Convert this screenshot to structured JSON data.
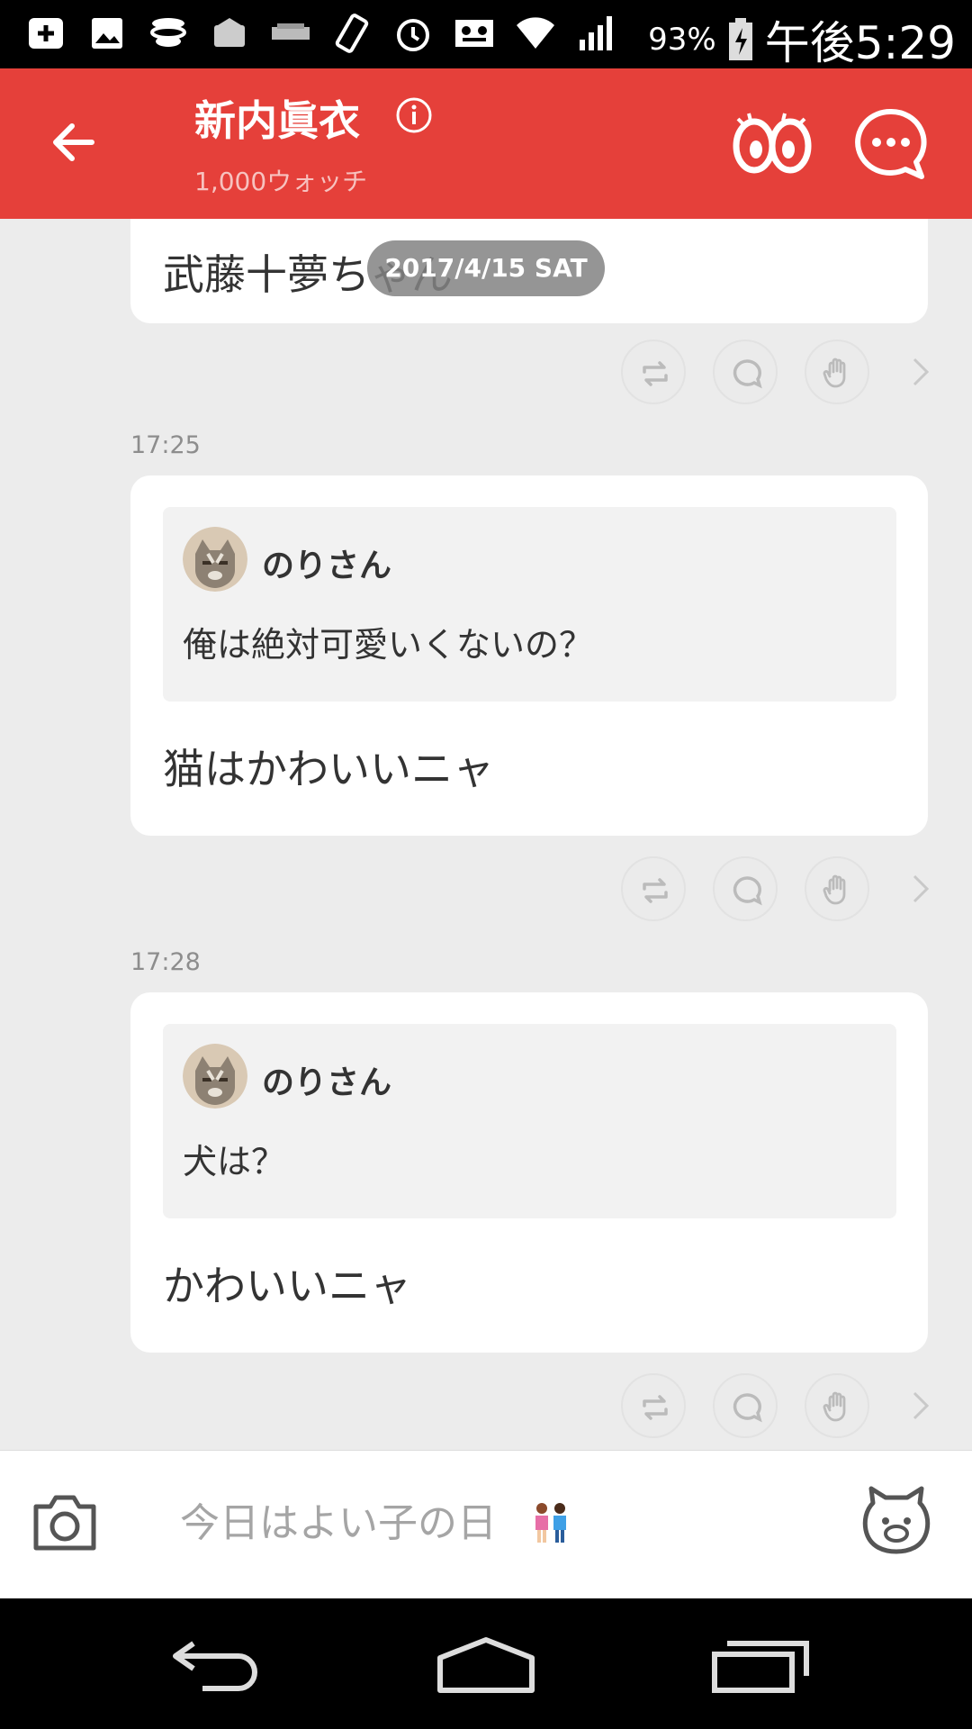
{
  "status_bar": {
    "battery_percent": "93%",
    "time": "午後5:29",
    "icons": [
      "add-box-icon",
      "image-icon",
      "stack-icon",
      "mail-icon",
      "badge-icon",
      "rotate-icon",
      "alarm-icon",
      "voicemail-icon",
      "wifi-icon",
      "signal-icon",
      "battery-icon"
    ]
  },
  "header": {
    "title": "新内眞衣",
    "subtitle": "1,000ウォッチ",
    "color": "#e5403a"
  },
  "feed": {
    "date_pill": "2017/4/15 SAT",
    "top_card_text": "武藤十夢ちゃん",
    "posts": [
      {
        "time": "17:25",
        "quote_name": "のりさん",
        "quote_text": "俺は絶対可愛いくないの？",
        "reply_text": "猫はかわいいニャ"
      },
      {
        "time": "17:28",
        "quote_name": "のりさん",
        "quote_text": "犬は？",
        "reply_text": "かわいいニャ"
      }
    ]
  },
  "composer": {
    "placeholder": "今日はよい子の日"
  }
}
